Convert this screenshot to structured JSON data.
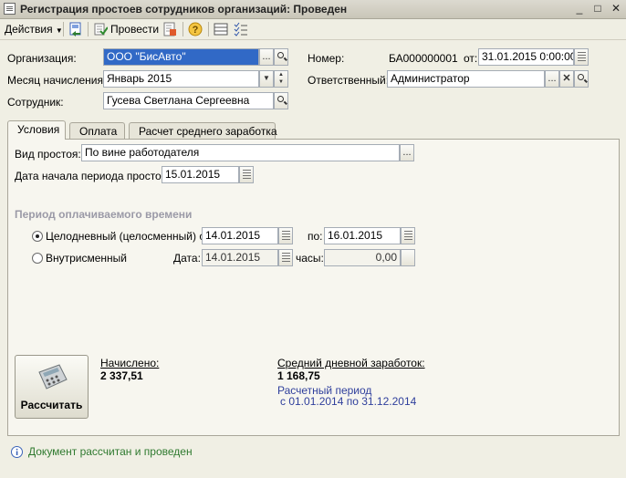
{
  "window": {
    "title": "Регистрация простоев сотрудников организаций: Проведен",
    "minimize": "_",
    "maximize": "□",
    "close": "✕"
  },
  "toolbar": {
    "actions_label": "Действия",
    "post_label": "Провести",
    "help": "?"
  },
  "header": {
    "organization_label": "Организация:",
    "organization_value": "ООО \"БисАвто\"",
    "month_label": "Месяц начисления:",
    "month_value": "Январь 2015",
    "employee_label": "Сотрудник:",
    "employee_value": "Гусева Светлана Сергеевна",
    "number_label": "Номер:",
    "number_value": "БА000000001",
    "date_label": "от:",
    "date_value": "31.01.2015 0:00:00",
    "responsible_label": "Ответственный:",
    "responsible_value": "Администратор",
    "ellipsis": "...",
    "clear": "✕",
    "spin_up": "▲",
    "spin_down": "▼",
    "dropdown": "▼"
  },
  "tabs": [
    {
      "label": "Условия"
    },
    {
      "label": "Оплата"
    },
    {
      "label": "Расчет среднего заработка"
    }
  ],
  "conditions": {
    "downtime_type_label": "Вид простоя:",
    "downtime_type_value": "По вине работодателя",
    "start_date_label": "Дата начала периода простоя:",
    "start_date_value": "15.01.2015",
    "section_title": "Период оплачиваемого времени",
    "fullday_label": "Целодневный (целосменный) с:",
    "fullday_from": "14.01.2015",
    "to_label": "по:",
    "fullday_to": "16.01.2015",
    "intraday_label": "Внутрисменный",
    "intraday_date_label": "Дата:",
    "intraday_date": "14.01.2015",
    "hours_label": "часы:",
    "hours_value": "0,00",
    "calc_button": "Рассчитать",
    "accrued_label": "Начислено:",
    "accrued_value": "2 337,51",
    "avg_label": "Средний дневной заработок:",
    "avg_value": "1 168,75",
    "calc_period_label": "Расчетный период",
    "calc_period_value": "с 01.01.2014 по 31.12.2014"
  },
  "status": {
    "text": "Документ рассчитан и проведен"
  }
}
